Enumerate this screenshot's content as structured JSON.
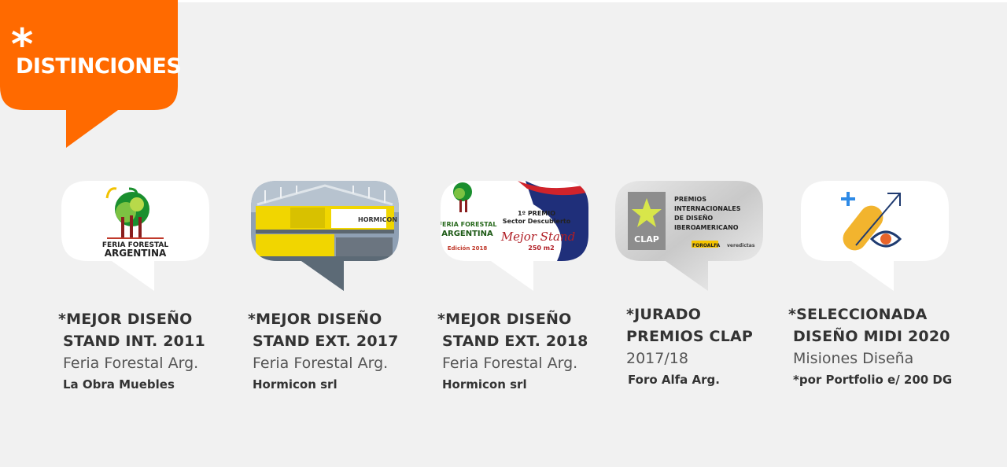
{
  "header": {
    "asterisk": "*",
    "title": "DISTINCIONES",
    "color": "#ff6a00"
  },
  "awards": [
    {
      "title_line1": "*MEJOR DISEÑO",
      "title_line2": "STAND INT. 2011",
      "event": "Feria Forestal Arg.",
      "client": "La Obra Muebles",
      "logo": {
        "line1": "FERIA FORESTAL",
        "line2": "ARGENTINA"
      }
    },
    {
      "title_line1": "*MEJOR DISEÑO",
      "title_line2": "STAND EXT. 2017",
      "event": "Feria Forestal Arg.",
      "client": "Hormicon srl",
      "logo": {
        "brand": "HORMICON"
      }
    },
    {
      "title_line1": "*MEJOR DISEÑO",
      "title_line2": "STAND EXT. 2018",
      "event": "Feria Forestal Arg.",
      "client": "Hormicon srl",
      "logo": {
        "line1": "FERIA FORESTAL",
        "line2": "ARGENTINA",
        "edition": "Edición 2018",
        "prize": "1º PREMIO",
        "sector": "Sector Descubierto",
        "stand": "Mejor Stand",
        "area": "250 m2"
      }
    },
    {
      "title_line1": "*JURADO",
      "title_line2": "PREMIOS CLAP",
      "event": "2017/18",
      "client": "Foro Alfa Arg.",
      "logo": {
        "name": "CLAP",
        "line1": "PREMIOS",
        "line2": "INTERNACIONALES",
        "line3": "DE DISEÑO",
        "line4": "IBEROAMERICANO",
        "partner1": "FOROALFA",
        "partner2": "veredictas"
      }
    },
    {
      "title_line1": "*SELECCIONADA",
      "title_line2": "DISEÑO MIDI 2020",
      "event": "Misiones Diseña",
      "client": "*por Portfolio e/ 200 DG",
      "logo": {
        "name": "midi-logo"
      }
    }
  ]
}
